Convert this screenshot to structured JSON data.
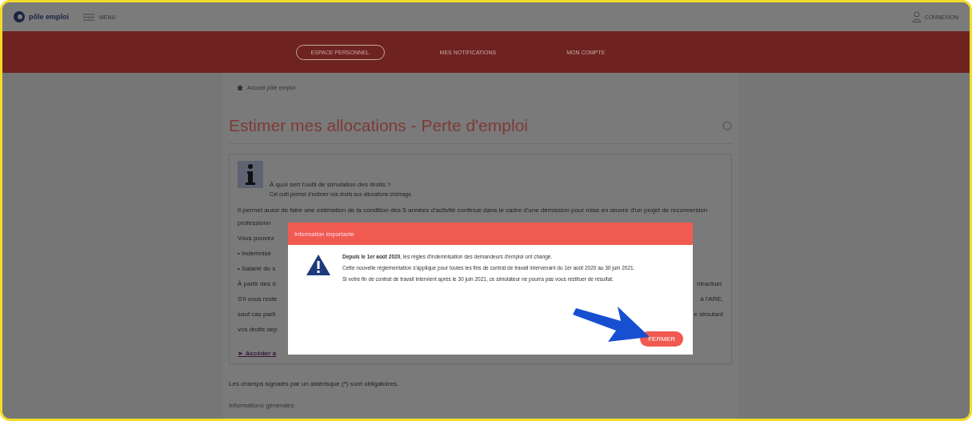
{
  "header": {
    "logo_text": "pôle emploi",
    "menu_label": "MENU",
    "account_label": "CONNEXION"
  },
  "nav": [
    {
      "label": "ESPACE PERSONNEL",
      "selected": true
    },
    {
      "label": "MES NOTIFICATIONS",
      "selected": false
    },
    {
      "label": "MON COMPTE",
      "selected": false
    }
  ],
  "breadcrumb": "Accueil pôle emploi",
  "page_title": "Estimer mes allocations - Perte d'emploi",
  "info_card": {
    "question": "À quoi sert l'outil de simulation des droits ?",
    "answer": "Cet outil permet d'estimer vos droits aux allocations chômage.",
    "intro": "Il permet aussi de faire une estimation de la condition des 5 années d'activité continue dans le cadre d'une démission pour mise en œuvre d'un projet de reconversion",
    "rows": [
      {
        "left": "professionn",
        "right": ""
      },
      {
        "left": "Vous pouvez",
        "right": ""
      },
      {
        "left": "• Indemnisé",
        "right": ""
      },
      {
        "left": "• Salarié du s",
        "right": ""
      },
      {
        "left": "À partir des d",
        "right": "ntractuel."
      },
      {
        "left": "S'il vous reste",
        "right": "à l'ARE,"
      },
      {
        "left": "sauf cas parti",
        "right": "e simulant"
      },
      {
        "left": "vos droits dep",
        "right": ""
      }
    ],
    "link": "► Accéder à"
  },
  "footnote": "Les champs signalés par un astérisque (*) sont obligatoires.",
  "section_title": "Informations générales",
  "modal": {
    "title": "Information importante",
    "lines": [
      "**Depuis le 1er août 2020**, les règles d'indemnisation des demandeurs d'emploi ont changé.",
      "Cette nouvelle réglementation s'applique pour toutes les fins de contrat de travail intervenant du 1er août 2020 au 30 juin 2021.",
      "Si votre fin de contrat de travail intervient après le 30 juin 2021, ce simulateur ne pourra pas vous restituer de résultat."
    ],
    "button": "FERMER"
  }
}
